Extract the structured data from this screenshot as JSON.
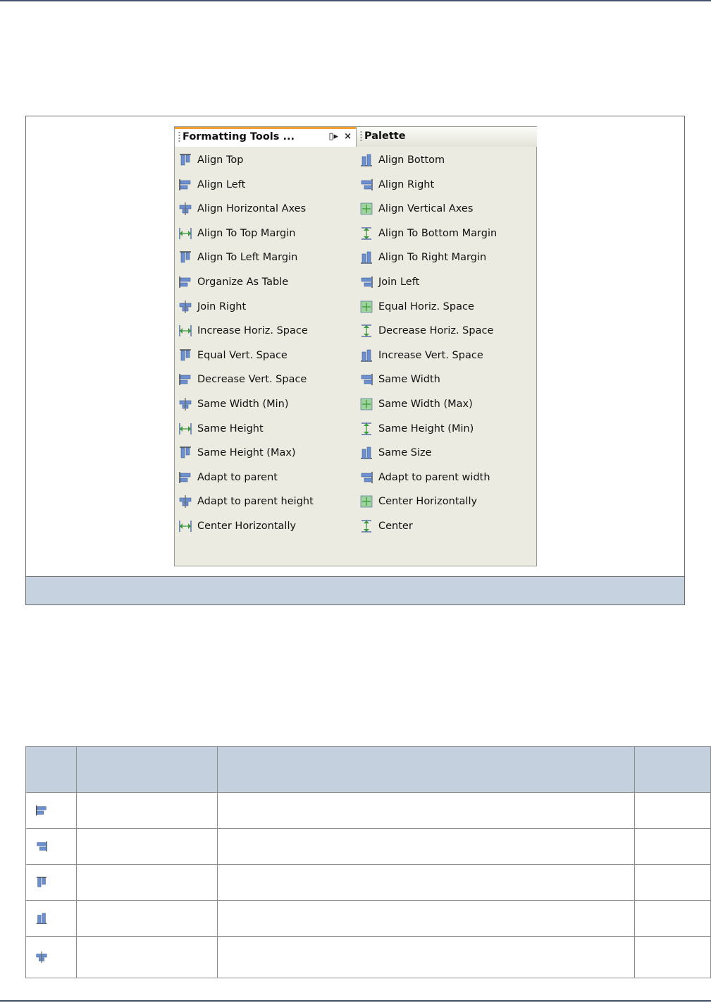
{
  "panel": {
    "active_tab": "Formatting Tools ...",
    "inactive_tab": "Palette",
    "tab_tools": {
      "menu_glyph": "▯▸",
      "close_glyph": "×"
    },
    "tools": [
      [
        "Align Top",
        "Align Bottom"
      ],
      [
        "Align Left",
        "Align Right"
      ],
      [
        "Align Horizontal Axes",
        "Align Vertical Axes"
      ],
      [
        "Align To Top Margin",
        "Align To Bottom Margin"
      ],
      [
        "Align To Left Margin",
        "Align To Right Margin"
      ],
      [
        "Organize As Table",
        "Join Left"
      ],
      [
        "Join Right",
        "Equal Horiz. Space"
      ],
      [
        "Increase Horiz. Space",
        "Decrease Horiz. Space"
      ],
      [
        "Equal Vert. Space",
        "Increase Vert. Space"
      ],
      [
        "Decrease Vert. Space",
        "Same Width"
      ],
      [
        "Same Width (Min)",
        "Same Width (Max)"
      ],
      [
        "Same Height",
        "Same Height (Min)"
      ],
      [
        "Same Height (Max)",
        "Same Size"
      ],
      [
        "Adapt to parent",
        "Adapt to parent width"
      ],
      [
        "Adapt to parent height",
        "Center Horizontally"
      ],
      [
        "Center Horizontally",
        "Center"
      ]
    ]
  },
  "table": {
    "rows": [
      {
        "icon": "align-left-icon"
      },
      {
        "icon": "align-right-icon"
      },
      {
        "icon": "align-top-icon"
      },
      {
        "icon": "align-bottom-icon"
      },
      {
        "icon": "align-horizontal-axes-icon"
      }
    ]
  },
  "colors": {
    "accent_tab": "#f0a030",
    "panel_bg": "#ecebe1",
    "header_bg": "#c5d0df",
    "icon_blue": "#6b8fcf",
    "icon_green": "#3b9a3b"
  }
}
